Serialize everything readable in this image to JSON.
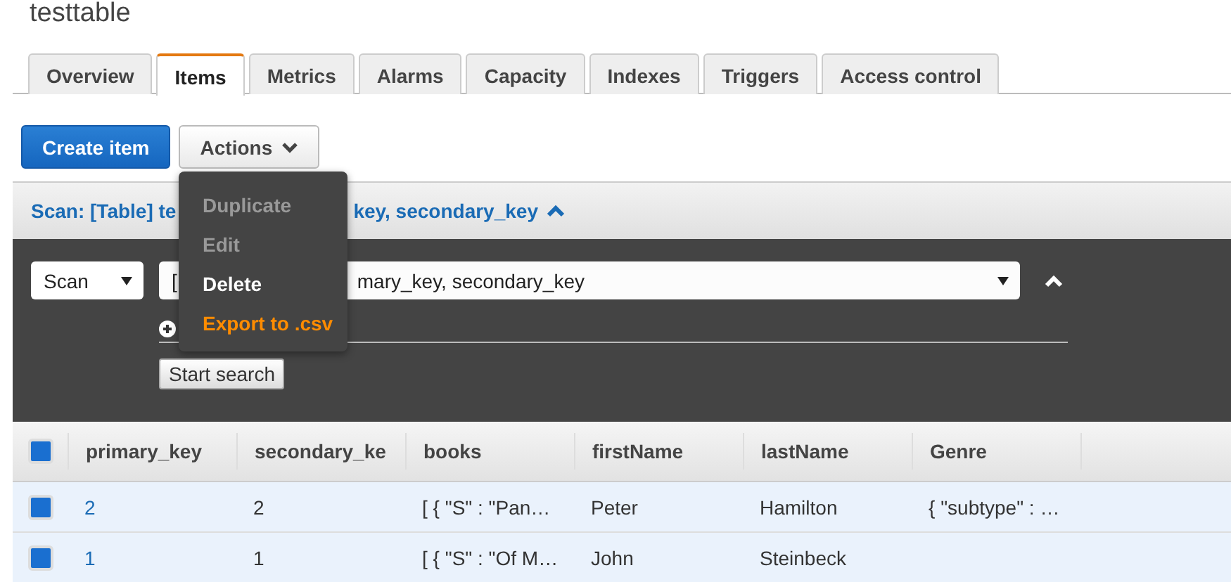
{
  "title": "testtable",
  "tabs": [
    {
      "label": "Overview",
      "selected": false
    },
    {
      "label": "Items",
      "selected": true
    },
    {
      "label": "Metrics",
      "selected": false
    },
    {
      "label": "Alarms",
      "selected": false
    },
    {
      "label": "Capacity",
      "selected": false
    },
    {
      "label": "Indexes",
      "selected": false
    },
    {
      "label": "Triggers",
      "selected": false
    },
    {
      "label": "Access control",
      "selected": false
    }
  ],
  "buttons": {
    "create": "Create item",
    "actions": "Actions"
  },
  "actions_menu": [
    {
      "label": "Duplicate",
      "disabled": true,
      "highlighted": false
    },
    {
      "label": "Edit",
      "disabled": true,
      "highlighted": false
    },
    {
      "label": "Delete",
      "disabled": false,
      "highlighted": false
    },
    {
      "label": "Export to .csv",
      "disabled": false,
      "highlighted": true
    }
  ],
  "scan_header": {
    "text_start": "Scan: [Table] te",
    "text_end": "key, secondary_key",
    "expanded": true
  },
  "scan_panel": {
    "mode": "Scan",
    "source_start": "[",
    "source_end": "mary_key, secondary_key",
    "start_button": "Start search"
  },
  "table": {
    "select_all_checked": true,
    "columns": [
      "primary_key",
      "secondary_ke",
      "books",
      "firstName",
      "lastName",
      "Genre"
    ],
    "rows": [
      {
        "selected": true,
        "cells": [
          "2",
          "2",
          "[ { \"S\" : \"Pan…",
          "Peter",
          "Hamilton",
          "{ \"subtype\" : …"
        ]
      },
      {
        "selected": true,
        "cells": [
          "1",
          "1",
          "[ { \"S\" : \"Of M…",
          "John",
          "Steinbeck",
          ""
        ]
      }
    ]
  }
}
